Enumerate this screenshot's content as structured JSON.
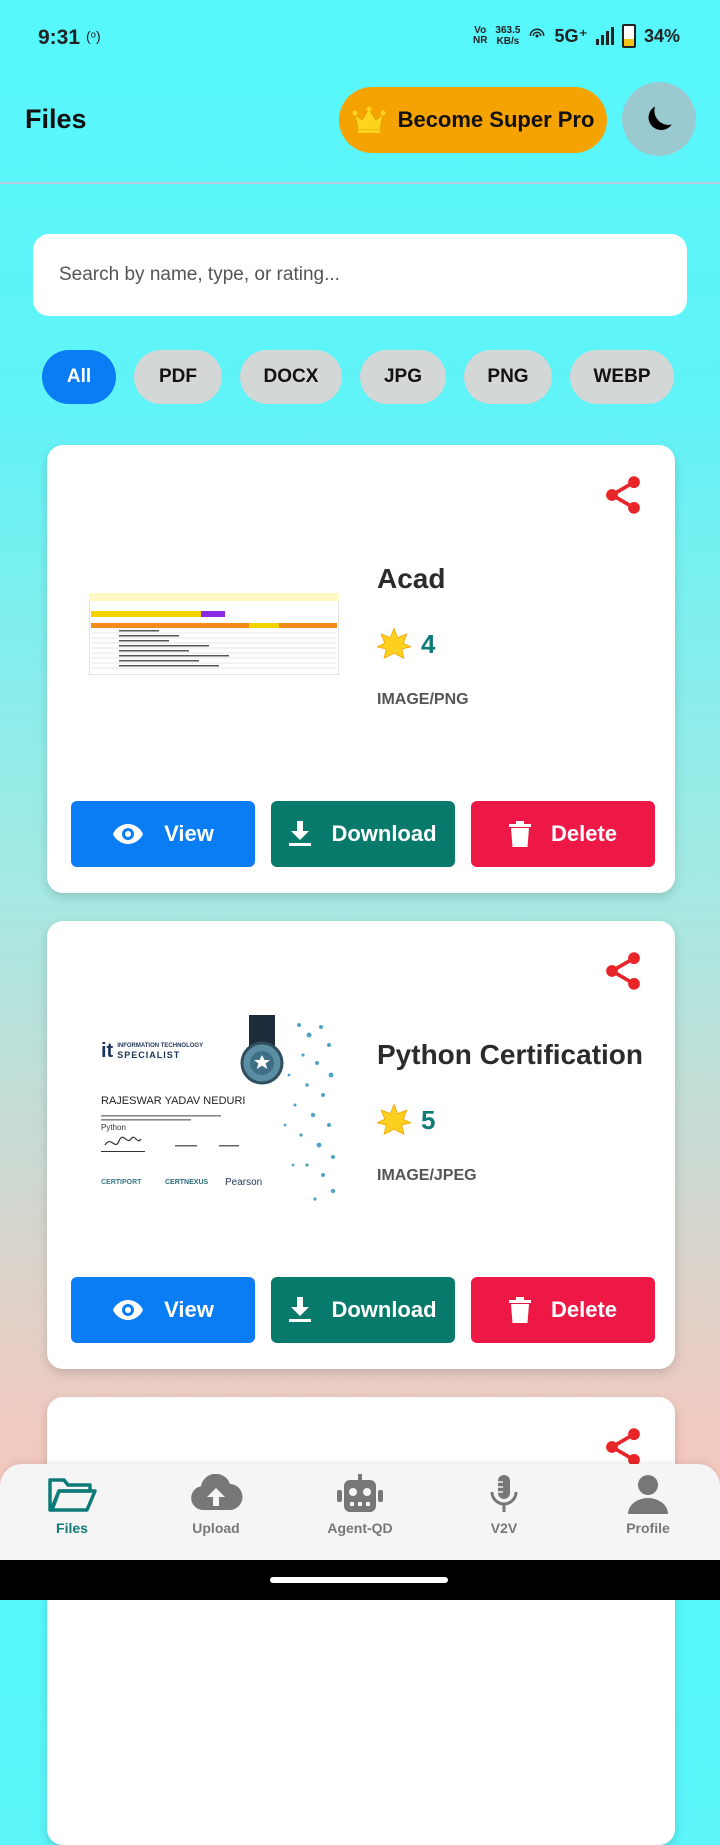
{
  "status": {
    "time": "9:31",
    "hotspot_icon": "(ᵒ)",
    "volte_top": "Vo",
    "volte_bottom": "NR",
    "speed_top": "363.5",
    "speed_bottom": "KB/s",
    "network": "5G⁺",
    "battery": "34%"
  },
  "header": {
    "title": "Files",
    "super_pro_label": "Become Super Pro"
  },
  "search": {
    "placeholder": "Search by name, type, or rating..."
  },
  "filters": [
    {
      "label": "All",
      "active": true
    },
    {
      "label": "PDF",
      "active": false
    },
    {
      "label": "DOCX",
      "active": false
    },
    {
      "label": "JPG",
      "active": false
    },
    {
      "label": "PNG",
      "active": false
    },
    {
      "label": "WEBP",
      "active": false
    }
  ],
  "cards": [
    {
      "name": "Acad",
      "rating": "4",
      "type": "IMAGE/PNG",
      "view_label": "View",
      "download_label": "Download",
      "delete_label": "Delete"
    },
    {
      "name": "Python Certification",
      "rating": "5",
      "type": "IMAGE/JPEG",
      "view_label": "View",
      "download_label": "Download",
      "delete_label": "Delete",
      "cert": {
        "org_line1": "INFORMATION TECHNOLOGY",
        "org_line2": "SPECIALIST",
        "recipient": "RAJESWAR YADAV NEDURI",
        "subject": "Python",
        "brand1": "CERTIPORT",
        "brand2": "CERTNEXUS",
        "brand3": "Pearson"
      }
    }
  ],
  "nav": [
    {
      "label": "Files",
      "icon": "folder-open-icon",
      "active": true
    },
    {
      "label": "Upload",
      "icon": "cloud-upload-icon",
      "active": false
    },
    {
      "label": "Agent-QD",
      "icon": "robot-icon",
      "active": false
    },
    {
      "label": "V2V",
      "icon": "microphone-icon",
      "active": false
    },
    {
      "label": "Profile",
      "icon": "user-icon",
      "active": false
    }
  ],
  "colors": {
    "accent_blue": "#0a7df5",
    "download_green": "#087a6b",
    "delete_red": "#ee1846",
    "super_pro_orange": "#f5a300",
    "share_red": "#e8262a",
    "active_nav": "#0f7b78"
  }
}
